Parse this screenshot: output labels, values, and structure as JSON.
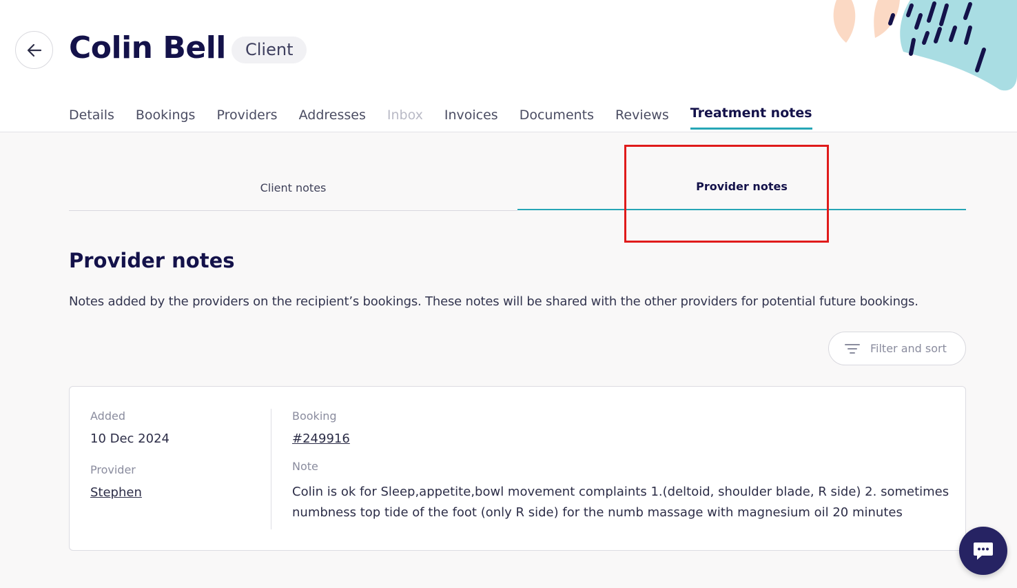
{
  "header": {
    "title": "Colin Bell",
    "role_badge": "Client"
  },
  "tabs": [
    {
      "label": "Details",
      "state": "default"
    },
    {
      "label": "Bookings",
      "state": "default"
    },
    {
      "label": "Providers",
      "state": "default"
    },
    {
      "label": "Addresses",
      "state": "default"
    },
    {
      "label": "Inbox",
      "state": "disabled"
    },
    {
      "label": "Invoices",
      "state": "default"
    },
    {
      "label": "Documents",
      "state": "default"
    },
    {
      "label": "Reviews",
      "state": "default"
    },
    {
      "label": "Treatment notes",
      "state": "active"
    }
  ],
  "subtabs": [
    {
      "label": "Client notes",
      "active": false
    },
    {
      "label": "Provider notes",
      "active": true
    }
  ],
  "section": {
    "title": "Provider notes",
    "description": "Notes added by the providers on the recipient’s bookings. These notes will be shared with the other providers for potential future bookings."
  },
  "filter_button": {
    "label": "Filter and sort",
    "icon": "filter-icon"
  },
  "note": {
    "added_label": "Added",
    "added_value": "10 Dec 2024",
    "provider_label": "Provider",
    "provider_value": "Stephen",
    "booking_label": "Booking",
    "booking_value": "#249916",
    "note_label": "Note",
    "note_value": "Colin is ok for Sleep,appetite,bowl movement complaints 1.(deltoid, shoulder blade, R side) 2. sometimes numbness top tide of the foot (only R side) for the numb massage with magnesium oil 20 minutes"
  },
  "colors": {
    "brand_navy": "#14124a",
    "accent_teal": "#26a6b6",
    "highlight_red": "#e01b1b",
    "chat_bg": "#262363"
  }
}
